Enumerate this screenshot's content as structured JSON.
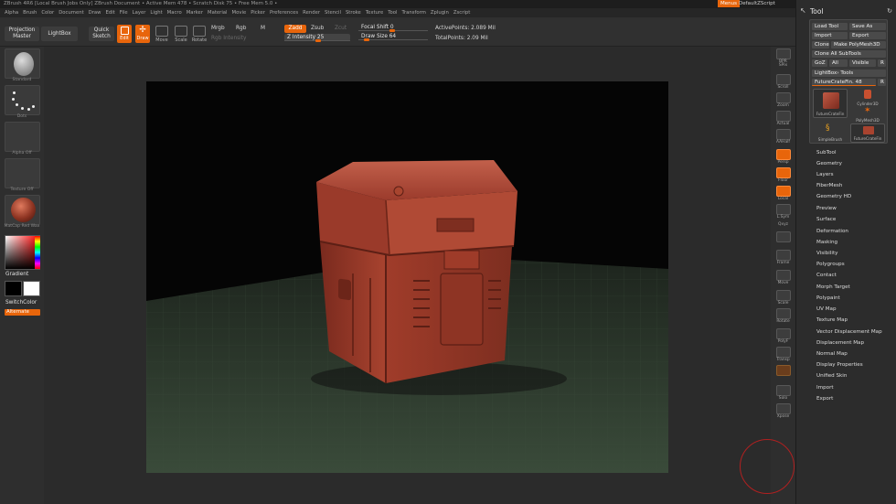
{
  "titlebar": {
    "text": "ZBrush 4R6 [Local Brush Jobs Only]   ZBrush Document   •  Active Mem 478 • Scratch Disk 75 • Free Mem 5.0 •",
    "menus": "Menus",
    "script": "DefaultZScript"
  },
  "menubar": [
    "Alpha",
    "Brush",
    "Color",
    "Document",
    "Draw",
    "Edit",
    "File",
    "Layer",
    "Light",
    "Macro",
    "Marker",
    "Material",
    "Movie",
    "Picker",
    "Preferences",
    "Render",
    "Stencil",
    "Stroke",
    "Texture",
    "Tool",
    "Transform",
    "Zplugin",
    "Zscript"
  ],
  "topshelf": {
    "projection_master": "Projection Master",
    "lightbox": "LightBox",
    "quick_sketch": "Quick Sketch",
    "edit": "Edit",
    "draw": "Draw",
    "move": "Move",
    "scale": "Scale",
    "rotate": "Rotate",
    "mrgb": "Mrgb",
    "rgb": "Rgb",
    "m": "M",
    "rgb_intensity": "Rgb Intensity",
    "zadd": "Zadd",
    "zsub": "Zsub",
    "zcut": "Zcut",
    "z_intensity_label": "Z Intensity",
    "z_intensity_value": "25",
    "z_intensity_fraction": 0.25,
    "focal_shift_label": "Focal Shift",
    "focal_shift_value": "0",
    "draw_size_label": "Draw Size",
    "draw_size_value": "64",
    "active_points_label": "ActivePoints:",
    "active_points_value": "2.089 Mil",
    "total_points_label": "TotalPoints:",
    "total_points_value": "2.09 Mil"
  },
  "leftshelf": {
    "standard": "Standard",
    "dots": "Dots",
    "alpha": "Alpha Off",
    "texture": "Texture Off",
    "material": "MatCap Red Wax",
    "gradient": "Gradient",
    "switch_color": "SwitchColor",
    "alternate": "Alternate"
  },
  "rightshelf": [
    "BPR",
    "SPix",
    "Scroll",
    "Zoom",
    "Actual",
    "AAHalf",
    "Persp",
    "Floor",
    "Local",
    "L.Sym",
    "Qxyz",
    "",
    "Frame",
    "Move",
    "Scale",
    "Rotate",
    "PolyF",
    "Transp",
    "",
    "Solo",
    "Xpose"
  ],
  "toolpanel": {
    "title": "Tool",
    "load_tool": "Load Tool",
    "save_as": "Save As",
    "import": "Import",
    "export": "Export",
    "clone": "Clone",
    "make_polymesh": "Make PolyMesh3D",
    "clone_all": "Clone All SubTools",
    "goz": "GoZ",
    "all": "All",
    "visible": "Visible",
    "r": "R",
    "lightbox_tools": "LightBox› Tools",
    "current_tool": "FutureCrateFin. 48",
    "thumbs": [
      "FutureCrateFin",
      "Cylinder3D",
      "PolyMesh3D",
      "SimpleBrush",
      "FutureCrateFin"
    ],
    "menu": [
      "SubTool",
      "Geometry",
      "Layers",
      "FiberMesh",
      "Geometry HD",
      "Preview",
      "Surface",
      "Deformation",
      "Masking",
      "Visibility",
      "Polygroups",
      "Contact",
      "Morph Target",
      "Polypaint",
      "UV Map",
      "Texture Map",
      "Vector Displacement Map",
      "Displacement Map",
      "Normal Map",
      "Display Properties",
      "Unified Skin",
      "Import",
      "Export"
    ]
  },
  "colors": {
    "accent": "#e8650b",
    "clay": "#9b3b2c",
    "floor": "#2f3d2f"
  }
}
